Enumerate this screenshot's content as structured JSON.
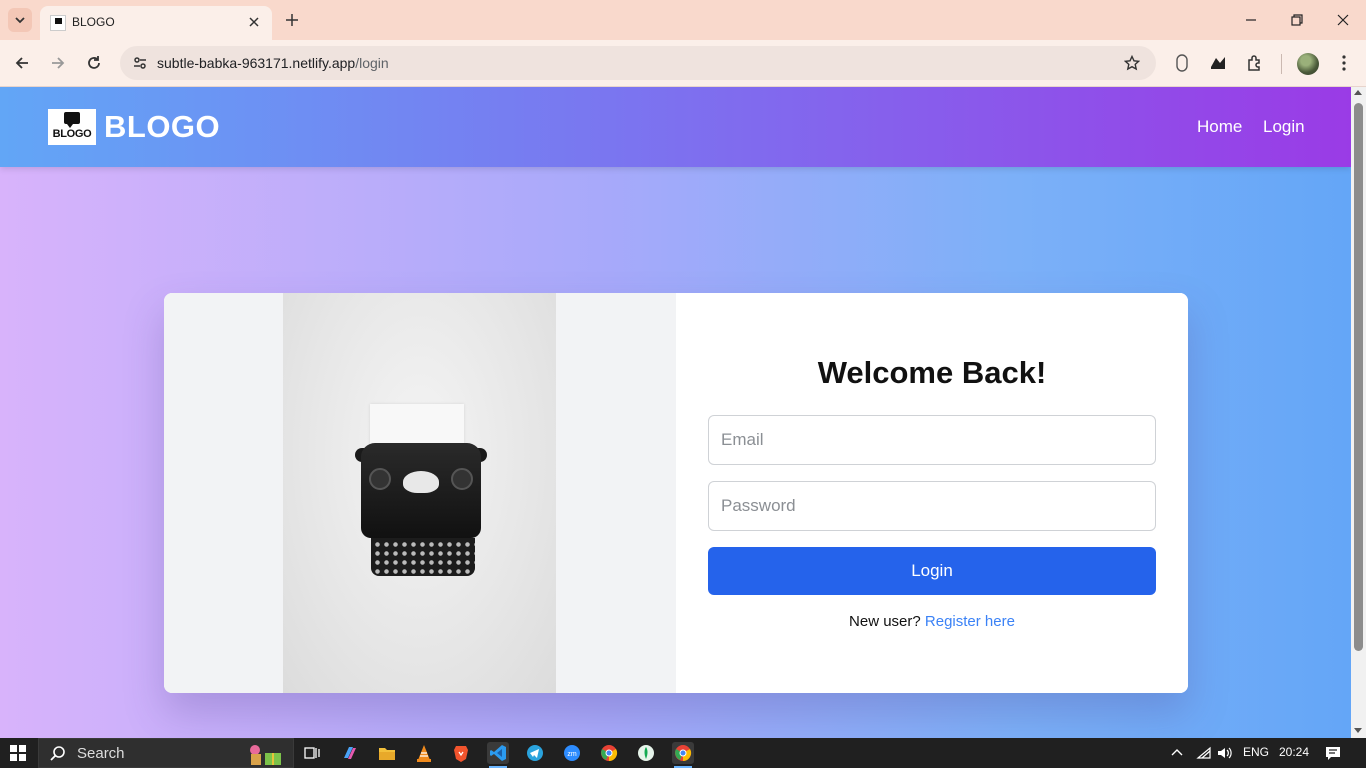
{
  "browser": {
    "tab_title": "BLOGO",
    "url_host": "subtle-babka-963171.netlify.app",
    "url_path": "/login"
  },
  "site": {
    "logo_text": "BLOGO",
    "brand": "BLOGO",
    "nav": {
      "home": "Home",
      "login": "Login"
    }
  },
  "login": {
    "title": "Welcome Back!",
    "email_placeholder": "Email",
    "password_placeholder": "Password",
    "button_label": "Login",
    "new_user_text": "New user?",
    "register_link": "Register here"
  },
  "taskbar": {
    "search_label": "Search",
    "language": "ENG",
    "time": "20:24"
  },
  "colors": {
    "accent": "#2563eb",
    "link": "#3b82f6",
    "header_gradient_start": "#62a6f6",
    "header_gradient_end": "#9a3be6"
  }
}
